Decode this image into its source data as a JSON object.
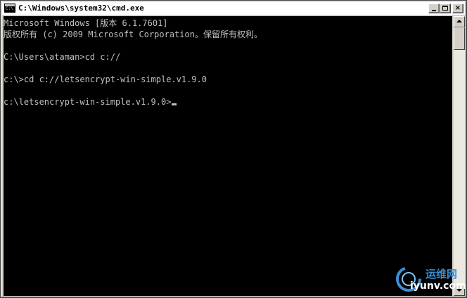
{
  "window": {
    "title": "C:\\Windows\\system32\\cmd.exe",
    "icon": "cmd-icon",
    "icon_glyph": "C:\\",
    "controls": {
      "minimize": "minimize-icon",
      "maximize": "maximize-icon",
      "close": "×"
    }
  },
  "console": {
    "lines": [
      "Microsoft Windows [版本 6.1.7601]",
      "版权所有 (c) 2009 Microsoft Corporation。保留所有权利。",
      "",
      "C:\\Users\\ataman>cd c://",
      "",
      "c:\\>cd c://letsencrypt-win-simple.v1.9.0",
      "",
      "c:\\letsencrypt-win-simple.v1.9.0>"
    ],
    "text_color": "#c0c0c0",
    "background": "#000000"
  },
  "watermark": {
    "brand_cn": "运维网",
    "url": "iyunv.com"
  }
}
